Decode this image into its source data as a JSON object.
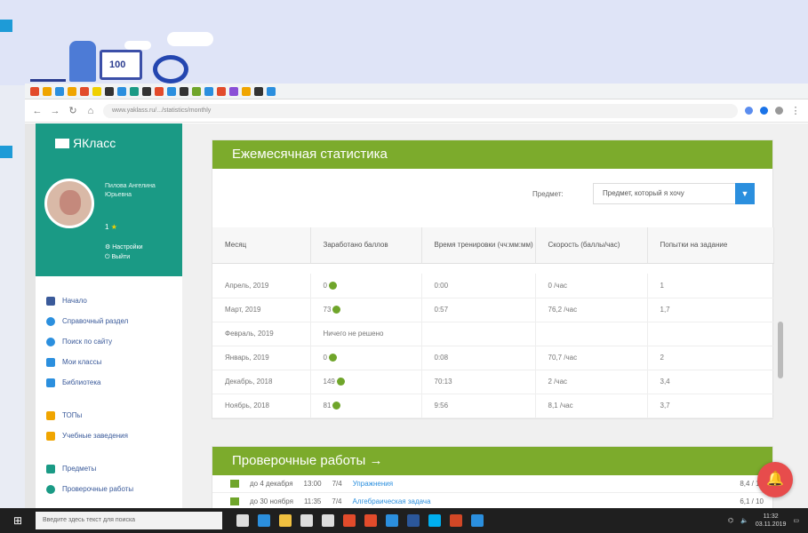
{
  "site": {
    "logo": "ЯКласс"
  },
  "browser": {
    "url": "www.yaklass.ru/.../statistics/monthly"
  },
  "sidebar": {
    "user_name": "Пилова Ангелина Юрьевна",
    "user_level": "1",
    "user_links": [
      "Настройки",
      "Выйти"
    ],
    "menu": [
      {
        "label": "Начало",
        "icon": "home-icon",
        "color": "#3a5a9a"
      },
      {
        "label": "Справочный раздел",
        "icon": "help-icon",
        "color": "#2b8fde"
      },
      {
        "label": "Поиск по сайту",
        "icon": "search-icon",
        "color": "#2b8fde"
      },
      {
        "label": "Мои классы",
        "icon": "people-icon",
        "color": "#2b8fde"
      },
      {
        "label": "Библиотека",
        "icon": "book-icon",
        "color": "#2b8fde"
      },
      {
        "label": "ТОПы",
        "icon": "star-icon",
        "color": "#f0a500"
      },
      {
        "label": "Учебные заведения",
        "icon": "school-icon",
        "color": "#f0a500"
      },
      {
        "label": "Предметы",
        "icon": "folder-icon",
        "color": "#1a9a85"
      },
      {
        "label": "Проверочные работы",
        "icon": "check-icon",
        "color": "#1a9a85"
      }
    ]
  },
  "stats": {
    "title": "Ежемесячная статистика",
    "filter_label": "Предмет:",
    "filter_value": "Предмет, который я хочу",
    "columns": [
      "Месяц",
      "Заработано баллов",
      "Время тренировки (чч:мм:мм)",
      "Скорость (баллы/час)",
      "Попытки на задание"
    ],
    "rows": [
      {
        "month": "Апрель, 2019",
        "points": "0",
        "time": "0:00",
        "speed": "0 /час",
        "attempts": "1"
      },
      {
        "month": "Март, 2019",
        "points": "73",
        "time": "0:57",
        "speed": "76,2 /час",
        "attempts": "1,7"
      },
      {
        "month": "Февраль, 2019",
        "points": "Ничего не решено",
        "time": "",
        "speed": "",
        "attempts": ""
      },
      {
        "month": "Январь, 2019",
        "points": "0",
        "time": "0:08",
        "speed": "70,7 /час",
        "attempts": "2"
      },
      {
        "month": "Декабрь, 2018",
        "points": "149",
        "time": "70:13",
        "speed": "2 /час",
        "attempts": "3,4"
      },
      {
        "month": "Ноябрь, 2018",
        "points": "81",
        "time": "9:56",
        "speed": "8,1 /час",
        "attempts": "3,7"
      }
    ]
  },
  "works": {
    "title": "Проверочные работы →",
    "rows": [
      {
        "date": "до 4 декабря",
        "time": "13:00",
        "score": "7/4",
        "link": "Упражнения",
        "right": "8,4 / 10"
      },
      {
        "date": "до 30 ноября",
        "time": "11:35",
        "score": "7/4",
        "link": "Алгебраическая задача",
        "right": "6,1 / 10"
      }
    ]
  },
  "taskbar": {
    "search_placeholder": "Введите здесь текст для поиска",
    "time": "11:32",
    "date": "03.11.2019"
  }
}
